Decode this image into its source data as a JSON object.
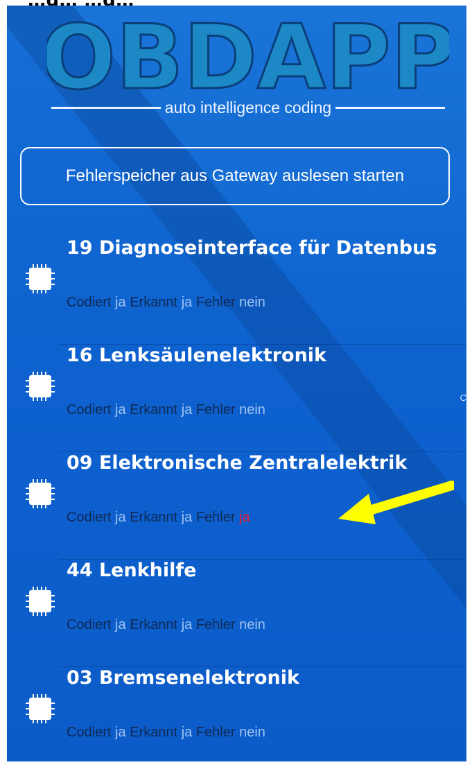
{
  "header": {
    "partial_text": "…g…   …g…"
  },
  "logo": {
    "text": "OBDAPP",
    "tagline": "auto intelligence coding"
  },
  "start_button": {
    "label": "Fehlerspeicher aus Gateway auslesen starten"
  },
  "ecus": [
    {
      "title": "19 Diagnoseinterface für Datenbus",
      "codiert_label": "Codiert",
      "codiert": "ja",
      "erkannt_label": "Erkannt",
      "erkannt": "ja",
      "fehler_label": "Fehler",
      "fehler": "nein"
    },
    {
      "title": "16 Lenksäulenelektronik",
      "codiert_label": "Codiert",
      "codiert": "ja",
      "erkannt_label": "Erkannt",
      "erkannt": "ja",
      "fehler_label": "Fehler",
      "fehler": "nein"
    },
    {
      "title": "09 Elektronische Zentralelektrik",
      "codiert_label": "Codiert",
      "codiert": "ja",
      "erkannt_label": "Erkannt",
      "erkannt": "ja",
      "fehler_label": "Fehler",
      "fehler": "ja"
    },
    {
      "title": "44 Lenkhilfe",
      "codiert_label": "Codiert",
      "codiert": "ja",
      "erkannt_label": "Erkannt",
      "erkannt": "ja",
      "fehler_label": "Fehler",
      "fehler": "nein"
    },
    {
      "title": "03 Bremsenelektronik",
      "codiert_label": "Codiert",
      "codiert": "ja",
      "erkannt_label": "Erkannt",
      "erkannt": "ja",
      "fehler_label": "Fehler",
      "fehler": "nein"
    }
  ],
  "edge_glyph": "C",
  "colors": {
    "background": "#0e63cf",
    "label": "#0e2a55",
    "value": "#9fc3f2",
    "error_value": "#e2243a",
    "annotation_arrow": "#ffff00"
  }
}
